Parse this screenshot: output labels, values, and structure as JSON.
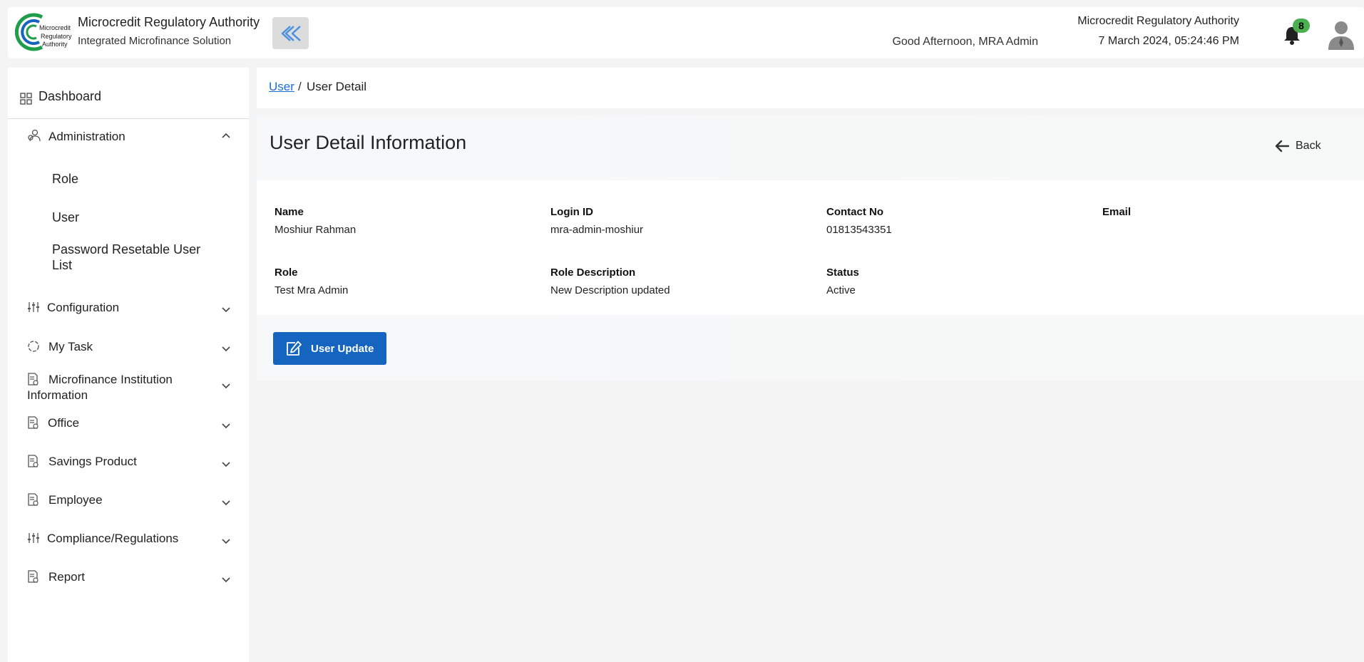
{
  "header": {
    "logo_lines": [
      "Microcredit",
      "Regulatory",
      "Authority"
    ],
    "org_name": "Microcredit Regulatory Authority",
    "org_sub": "Integrated Microfinance Solution",
    "greeting": "Good Afternoon, MRA Admin",
    "org_name_right": "Microcredit Regulatory Authority",
    "datetime": "7 March 2024, 05:24:46 PM",
    "notification_count": "8",
    "icons": {
      "collapse": "double-chevron-left-icon",
      "notifications": "bell-icon",
      "user": "user-avatar-icon"
    },
    "colors": {
      "badge": "#4caf50",
      "collapse_icon": "#4a90e2"
    }
  },
  "sidebar": {
    "dashboard": "Dashboard",
    "administration": {
      "label": "Administration",
      "children": [
        "Role",
        "User",
        "Password Resetable User",
        "List"
      ]
    },
    "items": [
      {
        "label": "Configuration",
        "icon": "sliders-icon"
      },
      {
        "label": "My Task",
        "icon": "circle-refresh-icon"
      },
      {
        "label": "Microfinance Institution",
        "label2": "Information",
        "icon": "document-icon"
      },
      {
        "label": "Office",
        "icon": "document-icon"
      },
      {
        "label": "Savings Product",
        "icon": "document-icon"
      },
      {
        "label": "Employee",
        "icon": "document-icon"
      },
      {
        "label": "Compliance/Regulations",
        "icon": "sliders-icon"
      },
      {
        "label": "Report",
        "icon": "document-icon"
      }
    ]
  },
  "breadcrumb": {
    "link": "User",
    "separator": "/",
    "current": "User Detail"
  },
  "panel": {
    "title": "User Detail Information",
    "back_label": "Back",
    "fields": {
      "name": {
        "label": "Name",
        "value": "Moshiur Rahman"
      },
      "login_id": {
        "label": "Login ID",
        "value": "mra-admin-moshiur"
      },
      "contact": {
        "label": "Contact No",
        "value": "01813543351"
      },
      "email": {
        "label": "Email",
        "value": ""
      },
      "role": {
        "label": "Role",
        "value": "Test Mra Admin"
      },
      "role_desc": {
        "label": "Role Description",
        "value": "New Description updated"
      },
      "status": {
        "label": "Status",
        "value": "Active"
      }
    },
    "update_label": "User Update",
    "colors": {
      "primary_button": "#1565c0",
      "link": "#1a6fd6"
    }
  }
}
